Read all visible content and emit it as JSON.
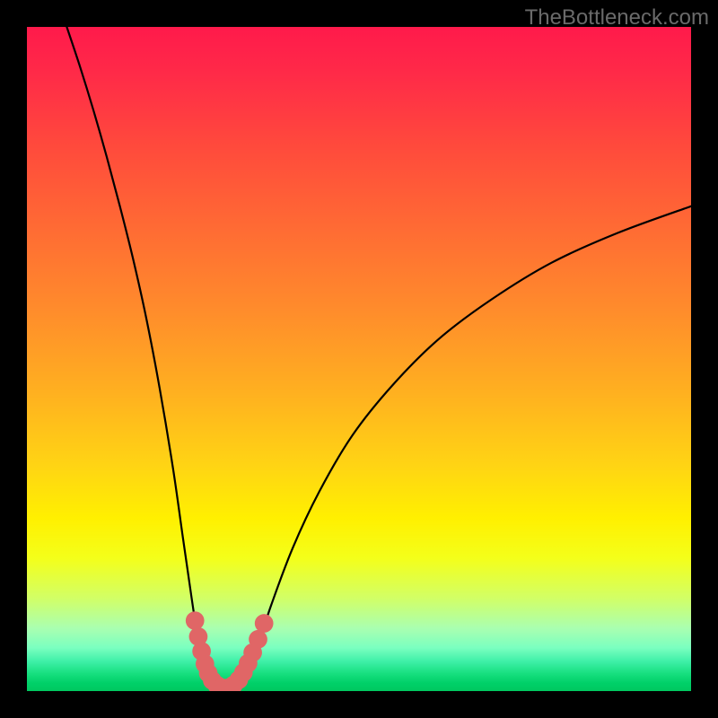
{
  "watermark": "TheBottleneck.com",
  "chart_data": {
    "type": "line",
    "title": "",
    "xlabel": "",
    "ylabel": "",
    "xlim": [
      0,
      1
    ],
    "ylim": [
      0,
      1
    ],
    "background_gradient_stops": [
      {
        "offset": 0.0,
        "color": "#ff1a4b"
      },
      {
        "offset": 0.07,
        "color": "#ff2a48"
      },
      {
        "offset": 0.18,
        "color": "#ff4a3c"
      },
      {
        "offset": 0.3,
        "color": "#ff6a34"
      },
      {
        "offset": 0.42,
        "color": "#ff8a2c"
      },
      {
        "offset": 0.55,
        "color": "#ffb020"
      },
      {
        "offset": 0.66,
        "color": "#ffd414"
      },
      {
        "offset": 0.74,
        "color": "#fff000"
      },
      {
        "offset": 0.8,
        "color": "#f4ff1a"
      },
      {
        "offset": 0.86,
        "color": "#d2ff66"
      },
      {
        "offset": 0.905,
        "color": "#aaffb0"
      },
      {
        "offset": 0.935,
        "color": "#7affc0"
      },
      {
        "offset": 0.955,
        "color": "#3ff0a8"
      },
      {
        "offset": 0.973,
        "color": "#18e080"
      },
      {
        "offset": 0.988,
        "color": "#00d068"
      },
      {
        "offset": 1.0,
        "color": "#00c860"
      }
    ],
    "series": [
      {
        "name": "bottleneck-curve",
        "stroke": "#000000",
        "points": [
          {
            "x": 0.06,
            "y": 1.0
          },
          {
            "x": 0.08,
            "y": 0.94
          },
          {
            "x": 0.1,
            "y": 0.875
          },
          {
            "x": 0.12,
            "y": 0.805
          },
          {
            "x": 0.14,
            "y": 0.73
          },
          {
            "x": 0.16,
            "y": 0.65
          },
          {
            "x": 0.18,
            "y": 0.56
          },
          {
            "x": 0.2,
            "y": 0.455
          },
          {
            "x": 0.22,
            "y": 0.335
          },
          {
            "x": 0.235,
            "y": 0.23
          },
          {
            "x": 0.248,
            "y": 0.14
          },
          {
            "x": 0.258,
            "y": 0.075
          },
          {
            "x": 0.266,
            "y": 0.04
          },
          {
            "x": 0.272,
            "y": 0.02
          },
          {
            "x": 0.278,
            "y": 0.01
          },
          {
            "x": 0.286,
            "y": 0.004
          },
          {
            "x": 0.296,
            "y": 0.002
          },
          {
            "x": 0.308,
            "y": 0.004
          },
          {
            "x": 0.318,
            "y": 0.01
          },
          {
            "x": 0.326,
            "y": 0.02
          },
          {
            "x": 0.336,
            "y": 0.04
          },
          {
            "x": 0.35,
            "y": 0.075
          },
          {
            "x": 0.368,
            "y": 0.13
          },
          {
            "x": 0.4,
            "y": 0.215
          },
          {
            "x": 0.44,
            "y": 0.3
          },
          {
            "x": 0.49,
            "y": 0.385
          },
          {
            "x": 0.55,
            "y": 0.46
          },
          {
            "x": 0.62,
            "y": 0.53
          },
          {
            "x": 0.7,
            "y": 0.59
          },
          {
            "x": 0.79,
            "y": 0.645
          },
          {
            "x": 0.89,
            "y": 0.69
          },
          {
            "x": 1.0,
            "y": 0.73
          }
        ]
      },
      {
        "name": "highlight-dots",
        "color": "#e06666",
        "radius_frac": 0.014,
        "points": [
          {
            "x": 0.253,
            "y": 0.106
          },
          {
            "x": 0.258,
            "y": 0.082
          },
          {
            "x": 0.263,
            "y": 0.06
          },
          {
            "x": 0.268,
            "y": 0.041
          },
          {
            "x": 0.273,
            "y": 0.027
          },
          {
            "x": 0.279,
            "y": 0.016
          },
          {
            "x": 0.286,
            "y": 0.009
          },
          {
            "x": 0.294,
            "y": 0.005
          },
          {
            "x": 0.303,
            "y": 0.005
          },
          {
            "x": 0.311,
            "y": 0.009
          },
          {
            "x": 0.319,
            "y": 0.017
          },
          {
            "x": 0.326,
            "y": 0.028
          },
          {
            "x": 0.333,
            "y": 0.042
          },
          {
            "x": 0.34,
            "y": 0.058
          },
          {
            "x": 0.348,
            "y": 0.078
          },
          {
            "x": 0.357,
            "y": 0.102
          }
        ]
      }
    ]
  }
}
